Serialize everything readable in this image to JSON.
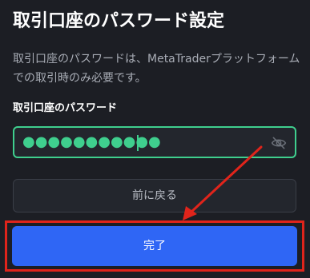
{
  "page": {
    "title": "取引口座のパスワード設定",
    "description": "取引口座のパスワードは、MetaTraderプラットフォームでの取引時のみ必要です。"
  },
  "password_field": {
    "label": "取引口座のパスワード",
    "masked_value": "●●●●●●●●●●●",
    "toggle_icon": "eye-off-icon"
  },
  "buttons": {
    "back_label": "前に戻る",
    "done_label": "完了"
  },
  "colors": {
    "accent_green": "#3fcf8e",
    "primary_blue": "#2f66f5",
    "annotation_red": "#e0241b",
    "background": "#1c1e24"
  }
}
